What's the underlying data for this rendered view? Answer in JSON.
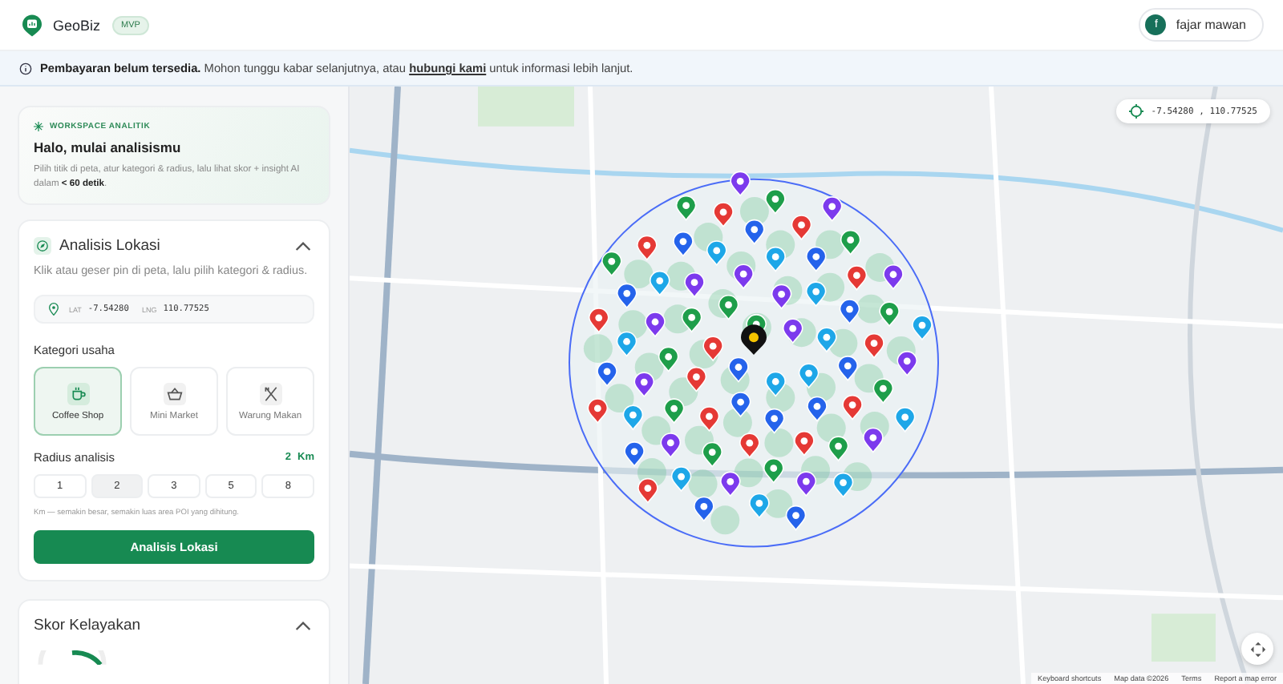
{
  "app": {
    "name": "GeoBiz",
    "badge": "MVP"
  },
  "user": {
    "initial": "f",
    "name": "fajar mawan"
  },
  "notice": {
    "bold": "Pembayaran belum tersedia.",
    "text": "Mohon tunggu kabar selanjutnya, atau",
    "link": "hubungi kami",
    "tail": "untuk informasi lebih lanjut."
  },
  "welcome": {
    "eyebrow": "WORKSPACE ANALITIK",
    "title": "Halo, mulai analisismu",
    "body": "Pilih titik di peta, atur kategori & radius, lalu lihat skor + insight AI dalam **< 60 detik**."
  },
  "analysis": {
    "title": "Analisis Lokasi",
    "expanded": true,
    "description": "Klik atau geser pin di peta, lalu pilih kategori & radius.",
    "lat_label": "LAT",
    "lat": "-7.54280",
    "lng_label": "LNG",
    "lng": "110.77525",
    "category_label": "Kategori usaha",
    "categories": [
      {
        "kind": "cup",
        "label": "Coffee Shop",
        "selected": true
      },
      {
        "kind": "basket",
        "label": "Mini Market",
        "selected": false
      },
      {
        "kind": "utensils",
        "label": "Warung Makan",
        "selected": false
      }
    ],
    "radius_label": "Radius analisis",
    "radius_value": "2",
    "radius_unit": "Km",
    "radius_options": [
      {
        "label": "1",
        "selected": false
      },
      {
        "label": "2",
        "selected": true
      },
      {
        "label": "3",
        "selected": false
      },
      {
        "label": "5",
        "selected": false
      },
      {
        "label": "8",
        "selected": false
      }
    ],
    "radius_hint": "Km — semakin besar, semakin luas area POI yang dihitung.",
    "button": "Analisis Lokasi"
  },
  "score": {
    "title": "Skor Kelayakan",
    "expanded": true
  },
  "map": {
    "coordinates": "-7.54280 , 110.77525",
    "footer": [
      "Keyboard shortcuts",
      "Map data ©2026",
      "Terms",
      "Report a map error"
    ]
  }
}
